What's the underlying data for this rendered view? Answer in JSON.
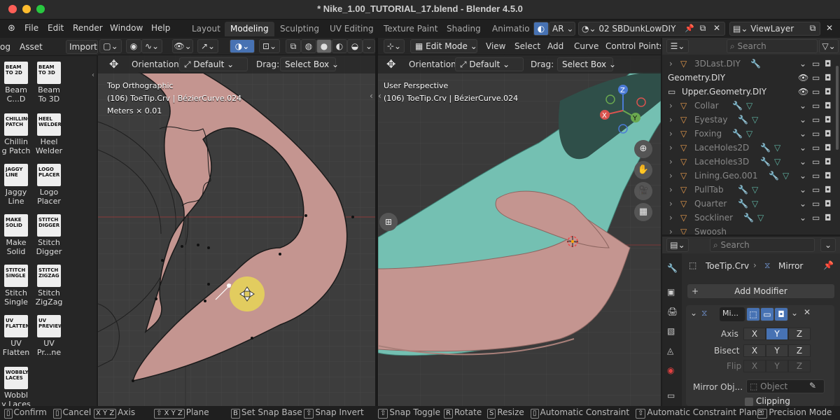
{
  "window": {
    "title": "* Nike_1.00_TUTORIAL_17.blend - Blender 4.5.0"
  },
  "menu": [
    "File",
    "Edit",
    "Render",
    "Window",
    "Help"
  ],
  "workspaces": [
    "Layout",
    "Modeling",
    "Sculpting",
    "UV Editing",
    "Texture Paint",
    "Shading",
    "Animatio"
  ],
  "active_workspace": "Modeling",
  "scene": {
    "mode_label": "AR",
    "scene_name": "02 SBDunkLowDIY",
    "view_layer": "ViewLayer"
  },
  "left_header": {
    "tab1": "og",
    "tab2": "Asset",
    "import": "Import"
  },
  "tools": [
    {
      "icon_text": "BEAM\nTO 2D",
      "label": "Beam\nC...D"
    },
    {
      "icon_text": "BEAM\nTO 3D",
      "label": "Beam\nTo 3D"
    },
    {
      "icon_text": "CHILLING\nPATCH",
      "label": "Chillin\ng Patch"
    },
    {
      "icon_text": "HEEL\nWELDER",
      "label": "Heel\nWelder"
    },
    {
      "icon_text": "JAGGY\nLINE",
      "label": "Jaggy\nLine"
    },
    {
      "icon_text": "LOGO\nPLACER",
      "label": "Logo\nPlacer"
    },
    {
      "icon_text": "MAKE\nSOLID",
      "label": "Make\nSolid"
    },
    {
      "icon_text": "STITCH\nDIGGER",
      "label": "Stitch\nDigger"
    },
    {
      "icon_text": "STITCH\nSINGLE",
      "label": "Stitch\nSingle"
    },
    {
      "icon_text": "STITCH\nZIGZAG",
      "label": "Stitch\nZigZag"
    },
    {
      "icon_text": "UV\nFLATTEN",
      "label": "UV\nFlatten"
    },
    {
      "icon_text": "UV\nPREVIEW",
      "label": "UV\nPr...ne"
    },
    {
      "icon_text": "WOBBLY\nLACES",
      "label": "Wobbl\ny Laces"
    }
  ],
  "viewport_left": {
    "orientation_label": "Orientation:",
    "orientation_value": "Default",
    "drag_label": "Drag:",
    "drag_value": "Select Box",
    "view_name": "Top Orthographic",
    "object_info": "(106) ToeTip.Crv | BézierCurve.024",
    "scale_info": "Meters × 0.01"
  },
  "viewport_right": {
    "mode": "Edit Mode",
    "menus": [
      "View",
      "Select",
      "Add",
      "Curve",
      "Control Points"
    ],
    "orientation_label": "Orientation:",
    "orientation_value": "Default",
    "drag_label": "Drag:",
    "drag_value": "Select Box",
    "view_name": "User Perspective",
    "object_info": "(106) ToeTip.Crv | BézierCurve.024",
    "gizmo": {
      "x": "X",
      "y": "Y",
      "z": "Z"
    }
  },
  "outliner": {
    "search_placeholder": "Search",
    "rows": [
      {
        "name": "3DLast.DIY",
        "indent": 1
      },
      {
        "name": "Geometry.DIY",
        "indent": 0
      },
      {
        "name": "Upper.Geometry.DIY",
        "indent": 0
      },
      {
        "name": "Collar",
        "indent": 1
      },
      {
        "name": "Eyestay",
        "indent": 1
      },
      {
        "name": "Foxing",
        "indent": 1
      },
      {
        "name": "LaceHoles2D",
        "indent": 1
      },
      {
        "name": "LaceHoles3D",
        "indent": 1
      },
      {
        "name": "Lining.Geo.001",
        "indent": 1
      },
      {
        "name": "PullTab",
        "indent": 1
      },
      {
        "name": "Quarter",
        "indent": 1
      },
      {
        "name": "Sockliner",
        "indent": 1
      },
      {
        "name": "Swoosh",
        "indent": 1
      }
    ]
  },
  "properties": {
    "search_placeholder": "Search",
    "object": "ToeTip.Crv",
    "modifier_breadcrumb": "Mirror",
    "add_modifier": "Add Modifier",
    "modifier_name": "Mi...",
    "axis_label": "Axis",
    "bisect_label": "Bisect",
    "flip_label": "Flip",
    "axes": [
      "X",
      "Y",
      "Z"
    ],
    "axis_active": "Y",
    "mirror_object_label": "Mirror Obj...",
    "mirror_object_placeholder": "Object",
    "clipping_label": "Clipping"
  },
  "statusbar": [
    {
      "keys": "",
      "label": "Confirm"
    },
    {
      "keys": "",
      "label": "Cancel"
    },
    {
      "keys": "X Y Z",
      "label": "Axis"
    },
    {
      "keys": "⇧ X Y Z",
      "label": "Plane"
    },
    {
      "keys": "B",
      "label": "Set Snap Base"
    },
    {
      "keys": "⇧",
      "label": "Snap Invert"
    },
    {
      "keys": "⇧",
      "label": "Snap Toggle"
    },
    {
      "keys": "R",
      "label": "Rotate"
    },
    {
      "keys": "S",
      "label": "Resize"
    },
    {
      "keys": "",
      "label": "Automatic Constraint"
    },
    {
      "keys": "⇧",
      "label": "Automatic Constraint Plane"
    },
    {
      "keys": "⇧",
      "label": "Precision Mode"
    }
  ],
  "colors": {
    "curve_fill": "#c49590",
    "mesh_teal": "#74c0b2",
    "active_axis": "#4772b3",
    "cursor_highlight": "#e6d25a"
  }
}
